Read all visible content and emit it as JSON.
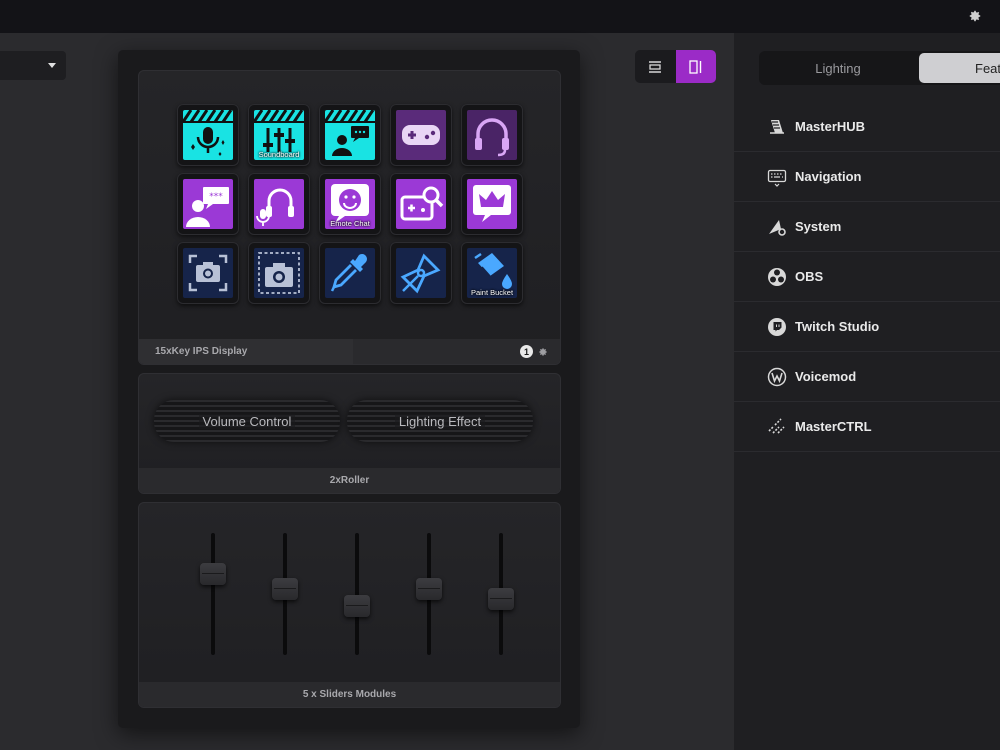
{
  "device": {
    "keys_module": {
      "label": "15xKey IPS Display",
      "badge": "1",
      "keys": [
        {
          "name": "mic-sparkle",
          "label": ""
        },
        {
          "name": "soundboard",
          "label": "Soundboard"
        },
        {
          "name": "person-chat",
          "label": ""
        },
        {
          "name": "gamepad",
          "label": ""
        },
        {
          "name": "headset",
          "label": ""
        },
        {
          "name": "person-password",
          "label": ""
        },
        {
          "name": "mic-headset",
          "label": ""
        },
        {
          "name": "emote-chat",
          "label": "Emote Chat"
        },
        {
          "name": "gamepad-search",
          "label": ""
        },
        {
          "name": "crown-chat",
          "label": ""
        },
        {
          "name": "screenshot",
          "label": ""
        },
        {
          "name": "screenshot-region",
          "label": ""
        },
        {
          "name": "eyedropper",
          "label": ""
        },
        {
          "name": "pen-tool",
          "label": ""
        },
        {
          "name": "paint-bucket",
          "label": "Paint Bucket"
        }
      ]
    },
    "roller_module": {
      "label": "2xRoller",
      "rollers": [
        "Volume Control",
        "Lighting Effect"
      ]
    },
    "slider_module": {
      "label": "5 x Sliders Modules",
      "sliders": [
        0.7,
        0.55,
        0.38,
        0.55,
        0.45
      ]
    }
  },
  "right_panel": {
    "tabs": [
      {
        "label": "Lighting",
        "active": false
      },
      {
        "label": "Featu",
        "active": true
      }
    ],
    "plugins": [
      {
        "label": "MasterHUB",
        "icon": "masterhub-icon"
      },
      {
        "label": "Navigation",
        "icon": "keyboard-icon"
      },
      {
        "label": "System",
        "icon": "system-icon"
      },
      {
        "label": "OBS",
        "icon": "obs-icon"
      },
      {
        "label": "Twitch Studio",
        "icon": "twitch-icon"
      },
      {
        "label": "Voicemod",
        "icon": "voicemod-icon"
      },
      {
        "label": "MasterCTRL",
        "icon": "masterctrl-icon"
      }
    ]
  },
  "colors": {
    "accent_purple": "#9b2bc7",
    "key_cyan": "#19e3e3",
    "key_purple": "#9b39d6",
    "key_navy": "#16244a"
  }
}
